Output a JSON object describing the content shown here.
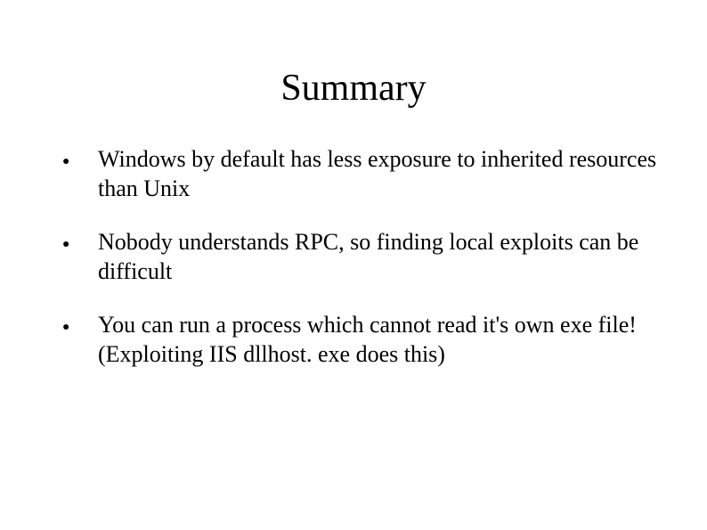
{
  "slide": {
    "title": "Summary",
    "bullets": [
      "Windows by default has less exposure to inherited resources than Unix",
      "Nobody understands RPC, so finding local exploits can be difficult",
      "You can run a process which cannot read it's own exe file! (Exploiting IIS dllhost. exe does this)"
    ]
  }
}
